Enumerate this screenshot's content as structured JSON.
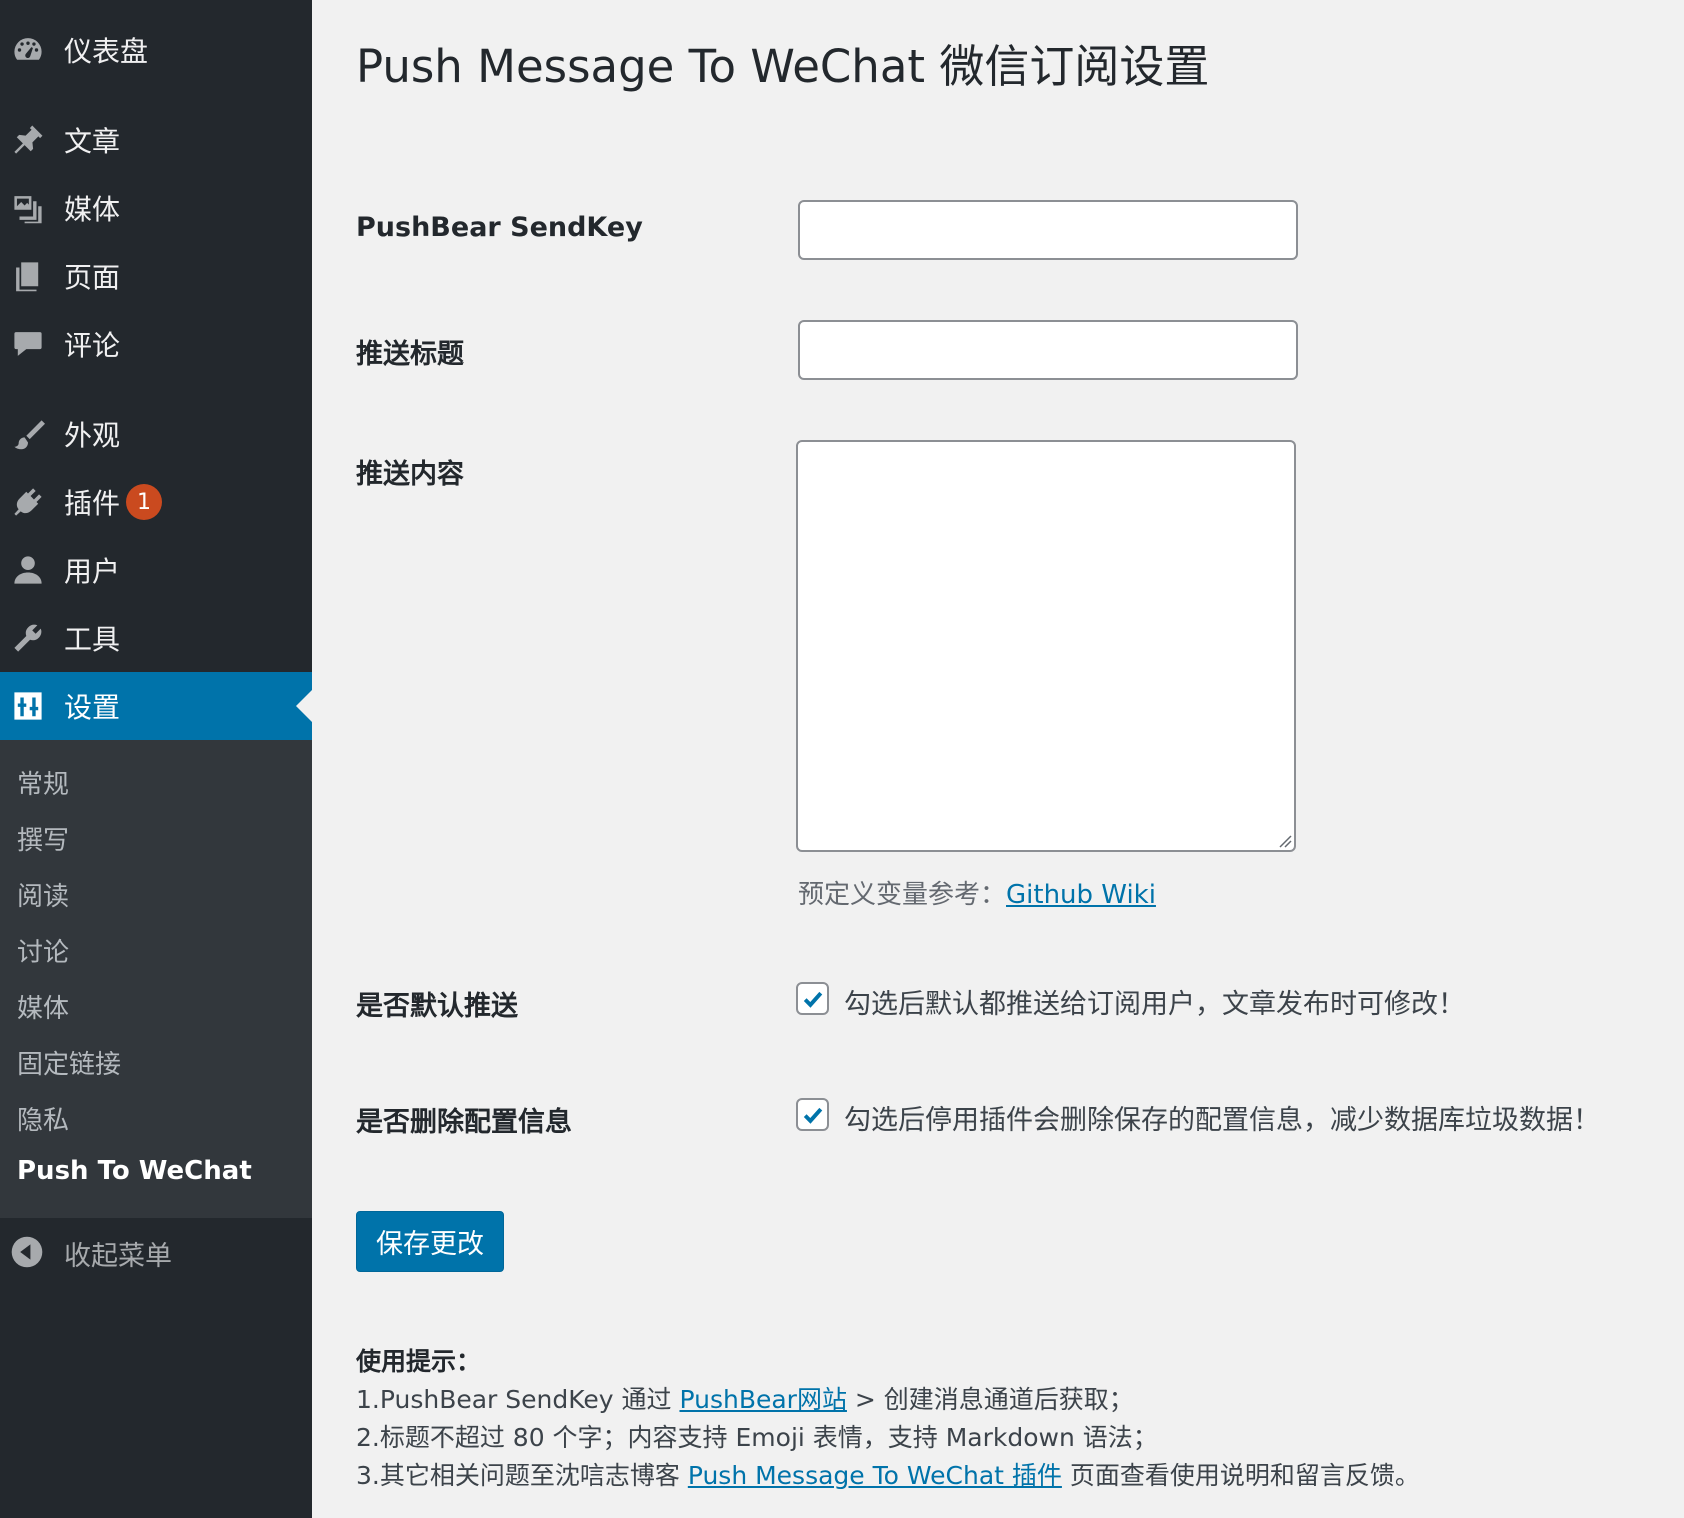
{
  "sidebar": {
    "dashboard": "仪表盘",
    "posts": "文章",
    "media": "媒体",
    "pages": "页面",
    "comments": "评论",
    "appearance": "外观",
    "plugins": "插件",
    "plugins_badge": "1",
    "users": "用户",
    "tools": "工具",
    "settings": "设置",
    "submenu": {
      "general": "常规",
      "writing": "撰写",
      "reading": "阅读",
      "discussion": "讨论",
      "media": "媒体",
      "permalinks": "固定链接",
      "privacy": "隐私",
      "push_to_wechat": "Push To WeChat"
    },
    "collapse": "收起菜单"
  },
  "page": {
    "title": "Push Message To WeChat 微信订阅设置"
  },
  "form": {
    "sendkey_label": "PushBear SendKey",
    "sendkey_value": "",
    "push_title_label": "推送标题",
    "push_title_value": "",
    "push_content_label": "推送内容",
    "push_content_value": "",
    "variables_hint_prefix": "预定义变量参考：",
    "variables_hint_link": "Github Wiki",
    "default_push_label": "是否默认推送",
    "default_push_checked": true,
    "default_push_desc": "勾选后默认都推送给订阅用户，文章发布时可修改！",
    "delete_config_label": "是否删除配置信息",
    "delete_config_checked": true,
    "delete_config_desc": "勾选后停用插件会删除保存的配置信息，减少数据库垃圾数据！",
    "save_label": "保存更改"
  },
  "tips": {
    "heading": "使用提示：",
    "line1_prefix": "1.PushBear SendKey 通过 ",
    "line1_link": "PushBear网站",
    "line1_suffix": " > 创建消息通道后获取；",
    "line2": "2.标题不超过 80 个字；内容支持 Emoji 表情，支持 Markdown 语法；",
    "line3_prefix": "3.其它相关问题至沈唁志博客 ",
    "line3_link": "Push Message To WeChat 插件",
    "line3_suffix": " 页面查看使用说明和留言反馈。"
  },
  "colors": {
    "sidebar_bg": "#23282d",
    "submenu_bg": "#32373c",
    "accent": "#0073aa",
    "badge": "#ca4a1f",
    "page_bg": "#f1f1f1"
  }
}
